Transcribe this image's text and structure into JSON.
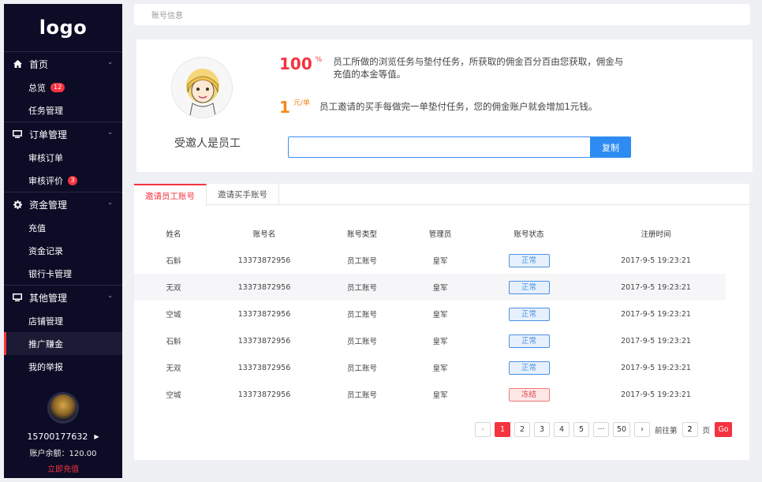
{
  "sidebar": {
    "logo": "logo",
    "groups": [
      {
        "label": "首页",
        "icon": "home-icon",
        "items": [
          {
            "label": "总览",
            "badge": "12"
          },
          {
            "label": "任务管理"
          }
        ]
      },
      {
        "label": "订单管理",
        "icon": "monitor-icon",
        "items": [
          {
            "label": "审核订单"
          },
          {
            "label": "审核评价",
            "badge": "3"
          }
        ]
      },
      {
        "label": "资金管理",
        "icon": "gear-icon",
        "items": [
          {
            "label": "充值"
          },
          {
            "label": "资金记录"
          },
          {
            "label": "银行卡管理"
          }
        ]
      },
      {
        "label": "其他管理",
        "icon": "monitor-icon",
        "items": [
          {
            "label": "店铺管理"
          },
          {
            "label": "推广赚金",
            "active": true
          },
          {
            "label": "我的举报"
          }
        ]
      }
    ],
    "user": {
      "phone": "15700177632",
      "balance": "账户余额：120.00",
      "recharge": "立即充值"
    }
  },
  "breadcrumb": "账号信息",
  "invite": {
    "label": "受邀人是员工",
    "promo1": {
      "big": "100",
      "unit": "%",
      "text": "员工所做的浏览任务与垫付任务，所获取的佣金百分百由您获取，佣金与充值的本金等值。"
    },
    "promo2": {
      "big": "1",
      "unit": "元/单",
      "text": "员工邀请的买手每做完一单垫付任务，您的佣金账户就会增加1元钱。"
    },
    "link_value": "",
    "copy_label": "复制"
  },
  "tabs": [
    {
      "label": "邀请员工账号",
      "active": true
    },
    {
      "label": "邀请买手账号"
    }
  ],
  "table": {
    "headers": [
      "姓名",
      "账号名",
      "账号类型",
      "管理员",
      "账号状态",
      "注册时间"
    ],
    "rows": [
      [
        "石斛",
        "13373872956",
        "员工账号",
        "皇军",
        "正常",
        "2017-9-5 19:23:21"
      ],
      [
        "无双",
        "13373872956",
        "员工账号",
        "皇军",
        "正常",
        "2017-9-5 19:23:21"
      ],
      [
        "空城",
        "13373872956",
        "员工账号",
        "皇军",
        "正常",
        "2017-9-5 19:23:21"
      ],
      [
        "石斛",
        "13373872956",
        "员工账号",
        "皇军",
        "正常",
        "2017-9-5 19:23:21"
      ],
      [
        "无双",
        "13373872956",
        "员工账号",
        "皇军",
        "正常",
        "2017-9-5 19:23:21"
      ],
      [
        "空城",
        "13373872956",
        "员工账号",
        "皇军",
        "冻结",
        "2017-9-5 19:23:21"
      ]
    ]
  },
  "pagination": {
    "prev": "‹",
    "pages": [
      "1",
      "2",
      "3",
      "4",
      "5"
    ],
    "ellipsis": "···",
    "last": "50",
    "next": "›",
    "goto_prefix": "前往第",
    "goto_value": "2",
    "goto_suffix": "页",
    "go_label": "Go"
  },
  "colors": {
    "accent": "#f5333f",
    "sidebar_bg": "#0d0c26",
    "primary_blue": "#2e8bf2",
    "orange": "#f08a1c"
  }
}
